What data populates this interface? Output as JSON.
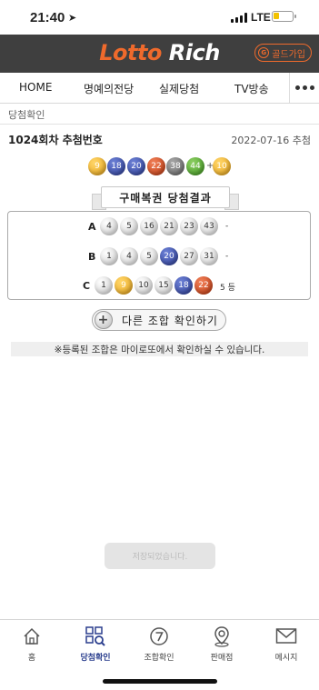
{
  "status_bar": {
    "time": "21:40",
    "network": "LTE"
  },
  "header": {
    "logo_part1": "Lotto",
    "logo_part2": "Rich",
    "gold_join": "골드가입",
    "gold_icon_glyph": "G"
  },
  "nav": {
    "tabs": [
      "HOME",
      "명예의전당",
      "실제당첨",
      "TV방송"
    ],
    "more_icon": "more-dots-icon"
  },
  "breadcrumb": "당첨확인",
  "draw": {
    "title": "1024회차 추첨번호",
    "date": "2022-07-16 추첨",
    "numbers": [
      9,
      18,
      20,
      22,
      38,
      44
    ],
    "bonus": 10,
    "plus_sign": "+"
  },
  "result_title": "구매복권 당첨결과",
  "results": [
    {
      "label": "A",
      "numbers": [
        4,
        5,
        16,
        21,
        23,
        43
      ],
      "rank": "-"
    },
    {
      "label": "B",
      "numbers": [
        1,
        4,
        5,
        20,
        27,
        31
      ],
      "rank": "-"
    },
    {
      "label": "C",
      "numbers": [
        1,
        9,
        10,
        15,
        18,
        22
      ],
      "rank": "5 등"
    }
  ],
  "combo_button": {
    "label": "다른 조합 확인하기",
    "icon": "plus-icon"
  },
  "notice": "※등록된 조합은 마이로또에서 확인하실 수 있습니다.",
  "toast": "저장되었습니다.",
  "footer": [
    {
      "label": "홈",
      "icon": "home-icon"
    },
    {
      "label": "당첨확인",
      "icon": "qr-search-icon",
      "active": true
    },
    {
      "label": "조합확인",
      "icon": "number-seven-icon"
    },
    {
      "label": "판매점",
      "icon": "map-pin-icon"
    },
    {
      "label": "메시지",
      "icon": "envelope-icon"
    }
  ],
  "colors": {
    "header_bg": "#3f3f3f",
    "logo_orange": "#ef6a2c",
    "active_blue": "#2b3f8e"
  }
}
